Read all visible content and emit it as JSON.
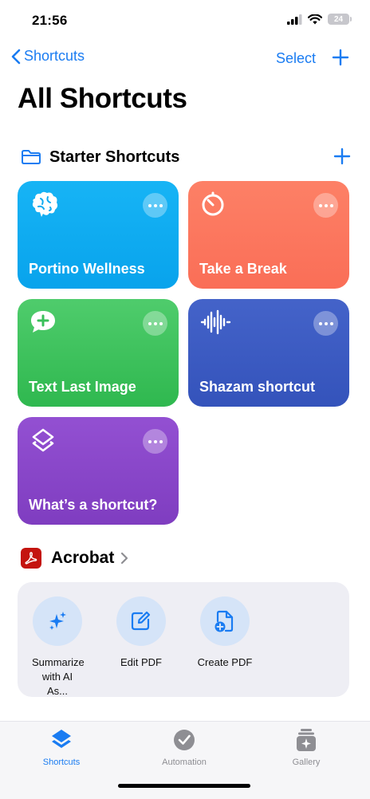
{
  "status_bar": {
    "time": "21:56",
    "battery": "24"
  },
  "nav": {
    "back_label": "Shortcuts",
    "select_label": "Select"
  },
  "title": "All Shortcuts",
  "starter_section": {
    "title": "Starter Shortcuts",
    "tiles": [
      {
        "label": "Portino Wellness",
        "color": "#10abf1",
        "icon": "brain-icon"
      },
      {
        "label": "Take a Break",
        "color": "#fb775f",
        "icon": "timer-icon"
      },
      {
        "label": "Text Last Image",
        "color": "#39c05a",
        "icon": "message-plus-icon"
      },
      {
        "label": "Shazam shortcut",
        "color": "#3a5bc2",
        "icon": "waveform-icon"
      },
      {
        "label": "What’s a shortcut?",
        "color": "#8947c9",
        "icon": "layers-icon"
      }
    ]
  },
  "acrobat_section": {
    "title": "Acrobat",
    "actions": [
      {
        "label": "Summarize with AI As...",
        "icon": "sparkles-icon"
      },
      {
        "label": "Edit PDF",
        "icon": "edit-icon"
      },
      {
        "label": "Create PDF",
        "icon": "create-doc-icon"
      }
    ]
  },
  "tab_bar": {
    "tabs": [
      {
        "label": "Shortcuts",
        "active": true
      },
      {
        "label": "Automation",
        "active": false
      },
      {
        "label": "Gallery",
        "active": false
      }
    ],
    "active_color": "#1a7cf2",
    "inactive_color": "#8e8e93"
  }
}
